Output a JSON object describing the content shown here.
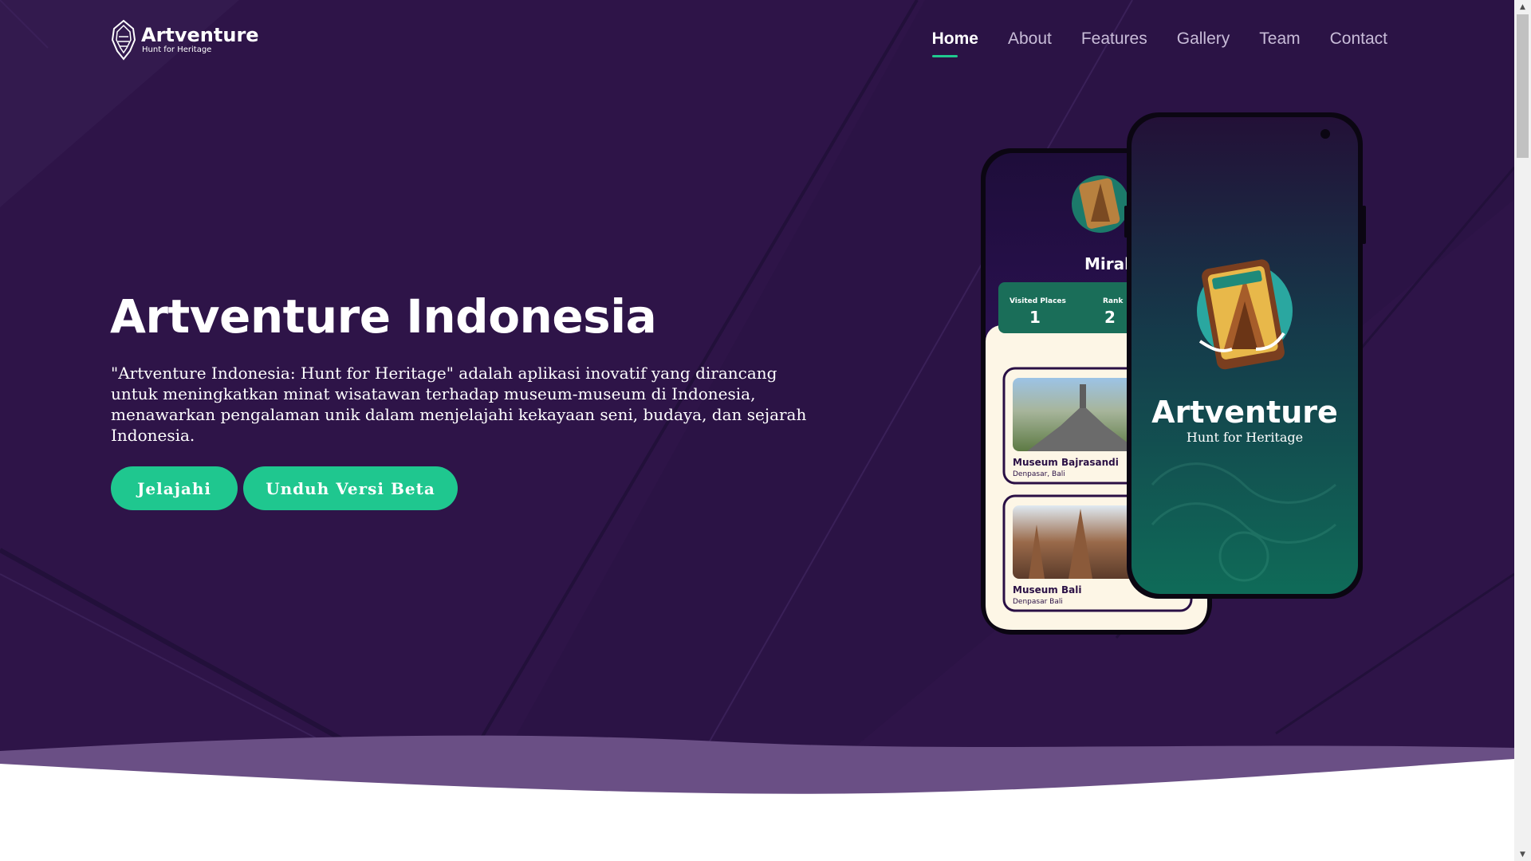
{
  "nav": {
    "logo": {
      "title": "Artventure",
      "subtitle": "Hunt for Heritage"
    },
    "items": [
      {
        "label": "Home",
        "active": true
      },
      {
        "label": "About",
        "active": false
      },
      {
        "label": "Features",
        "active": false
      },
      {
        "label": "Gallery",
        "active": false
      },
      {
        "label": "Team",
        "active": false
      },
      {
        "label": "Contact",
        "active": false
      }
    ]
  },
  "hero": {
    "title": "Artventure Indonesia",
    "description": "\"Artventure Indonesia: Hunt for Heritage\" adalah aplikasi inovatif yang dirancang untuk meningkatkan minat wisatawan terhadap museum-museum di Indonesia, menawarkan pengalaman unik dalam menjelajahi kekayaan seni, budaya, dan sejarah Indonesia.",
    "buttons": {
      "explore": "Jelajahi",
      "download": "Unduh Versi Beta"
    }
  },
  "phone_back": {
    "user_name": "Mirah Wa",
    "stats": [
      {
        "label": "Visited Places",
        "value": "1"
      },
      {
        "label": "Rank",
        "value": "2"
      }
    ],
    "museums": [
      {
        "name": "Museum Bajrasandi",
        "location": "Denpasar, Bali"
      },
      {
        "name": "Museum Bali",
        "location": "Denpasar Bali"
      }
    ]
  },
  "phone_front": {
    "app_title": "Artventure",
    "app_subtitle": "Hunt for Heritage"
  },
  "colors": {
    "background": "#2e1448",
    "accent": "#1fc78f",
    "text": "#ffffff",
    "nav_inactive": "#c8bcd8"
  }
}
